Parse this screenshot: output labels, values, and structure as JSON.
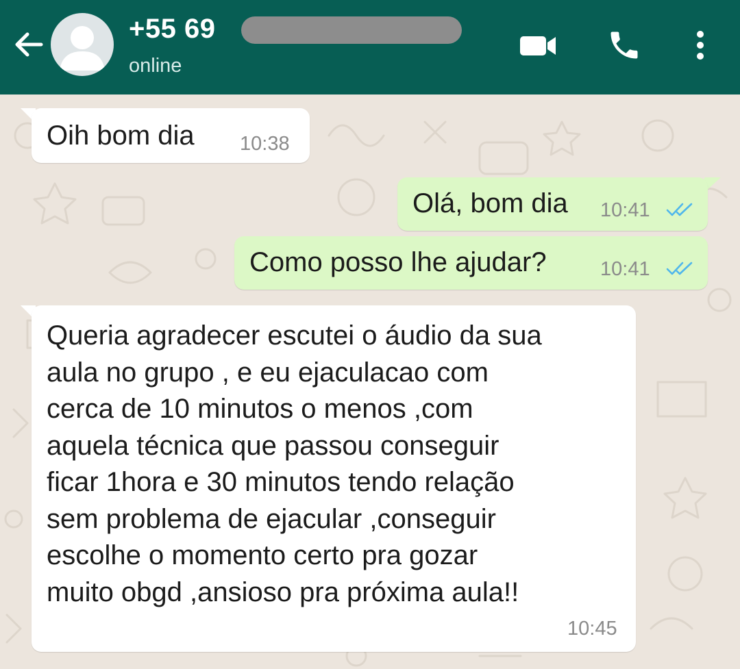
{
  "header": {
    "contact_name": "+55 69",
    "status": "online",
    "back_icon": "arrow-left-icon",
    "video_icon": "video-call-icon",
    "call_icon": "phone-icon",
    "menu_icon": "more-vert-icon",
    "background_color": "#075e54"
  },
  "chat": {
    "wallpaper_color": "#ece5dd",
    "incoming_bubble_color": "#ffffff",
    "outgoing_bubble_color": "#dcf8c6",
    "read_tick_color": "#4fb6ec",
    "messages": [
      {
        "direction": "incoming",
        "text": "Oih bom dia",
        "time": "10:38"
      },
      {
        "direction": "outgoing",
        "text": "Olá, bom dia",
        "time": "10:41",
        "status": "read"
      },
      {
        "direction": "outgoing",
        "text": "Como posso lhe ajudar?",
        "time": "10:41",
        "status": "read"
      },
      {
        "direction": "incoming",
        "text": "Queria agradecer escutei o áudio da sua\naula no grupo , e eu ejaculacao com\ncerca de 10 minutos o menos ,com\naquela técnica que passou conseguir\nficar 1hora e 30 minutos  tendo relação\nsem problema de ejacular ,conseguir\nescolhe o momento certo pra gozar\nmuito obgd ,ansioso pra próxima aula!!",
        "time": "10:45"
      }
    ]
  }
}
